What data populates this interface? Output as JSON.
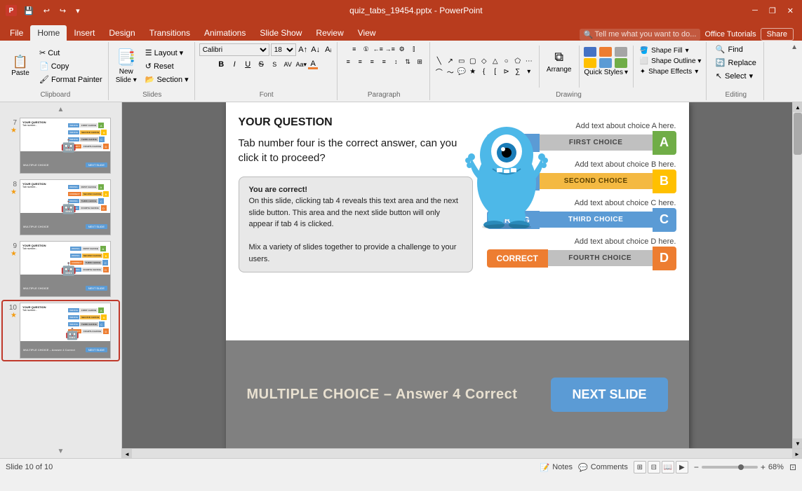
{
  "titlebar": {
    "filename": "quiz_tabs_19454.pptx - PowerPoint",
    "quickaccess": [
      "save",
      "undo",
      "redo",
      "customize"
    ],
    "controls": [
      "minimize",
      "restore",
      "close"
    ]
  },
  "ribbontabs": {
    "tabs": [
      "File",
      "Home",
      "Insert",
      "Design",
      "Transitions",
      "Animations",
      "Slide Show",
      "Review",
      "View"
    ],
    "active": "Home",
    "rightitems": [
      "Office Tutorials",
      "Share"
    ],
    "search_placeholder": "Tell me what you want to do..."
  },
  "ribbon": {
    "groups": {
      "clipboard": {
        "label": "Clipboard",
        "paste": "Paste",
        "cut": "Cut",
        "copy": "Copy",
        "format_painter": "Format Painter"
      },
      "slides": {
        "label": "Slides",
        "new_slide": "New Slide",
        "layout": "Layout",
        "reset": "Reset",
        "section": "Section"
      },
      "font": {
        "label": "Font",
        "font_name": "Calibri",
        "font_size": "18",
        "bold": "B",
        "italic": "I",
        "underline": "U",
        "strikethrough": "S",
        "shadow": "S",
        "font_color": "A"
      },
      "paragraph": {
        "label": "Paragraph",
        "bullets": "Bullets",
        "numbering": "Numbering",
        "decrease_indent": "Decrease",
        "increase_indent": "Increase",
        "align_left": "Left",
        "center": "Center",
        "align_right": "Right",
        "justify": "Justify",
        "columns": "Columns",
        "line_spacing": "Line Spacing",
        "direction": "Direction",
        "align_text": "Align Text",
        "convert_smartart": "SmartArt"
      },
      "drawing": {
        "label": "Drawing",
        "arrange": "Arrange",
        "quick_styles_label": "Quick Styles",
        "shape_fill": "Shape Fill",
        "shape_outline": "Shape Outline",
        "shape_effects": "Shape Effects"
      },
      "editing": {
        "label": "Editing",
        "find": "Find",
        "replace": "Replace",
        "select": "Select"
      }
    }
  },
  "slides": {
    "current": 10,
    "total": 10,
    "thumbnails": [
      {
        "num": "7",
        "star": true,
        "label": "Slide 7"
      },
      {
        "num": "8",
        "star": true,
        "label": "Slide 8"
      },
      {
        "num": "9",
        "star": true,
        "label": "Slide 9"
      },
      {
        "num": "10",
        "star": true,
        "label": "Slide 10",
        "active": true
      }
    ]
  },
  "slide_content": {
    "question_title": "YOUR QUESTION",
    "question_text": "Tab number four is the correct answer, can you click it to proceed?",
    "correct_bubble_title": "You are correct!",
    "correct_bubble_text": "On this slide, clicking tab 4 reveals this text area and the next slide button. This area and the next slide button will only appear if tab 4 is clicked.\n\nMix a variety of slides together to provide a challenge to your users.",
    "choices": [
      {
        "label_text": "Add text about choice A here.",
        "status": "WRONG",
        "choice_label": "FIRST CHOICE",
        "letter": "A",
        "letter_class": "letter-a"
      },
      {
        "label_text": "Add text about choice B here.",
        "status": "WRONG",
        "choice_label": "SECOND CHOICE",
        "letter": "B",
        "letter_class": "letter-b"
      },
      {
        "label_text": "Add text about choice C here.",
        "status": "WRONG",
        "choice_label": "THIRD CHOICE",
        "letter": "C",
        "letter_class": "letter-c"
      },
      {
        "label_text": "Add text about choice D here.",
        "status": "CORRECT",
        "choice_label": "FOURTH CHOICE",
        "letter": "D",
        "letter_class": "letter-d"
      }
    ],
    "bottom_text": "MULTIPLE CHOICE – Answer 4 Correct",
    "next_slide_label": "NEXT SLIDE"
  },
  "statusbar": {
    "slide_info": "Slide 10 of 10",
    "notes_label": "Notes",
    "comments_label": "Comments",
    "zoom_level": "68%"
  }
}
